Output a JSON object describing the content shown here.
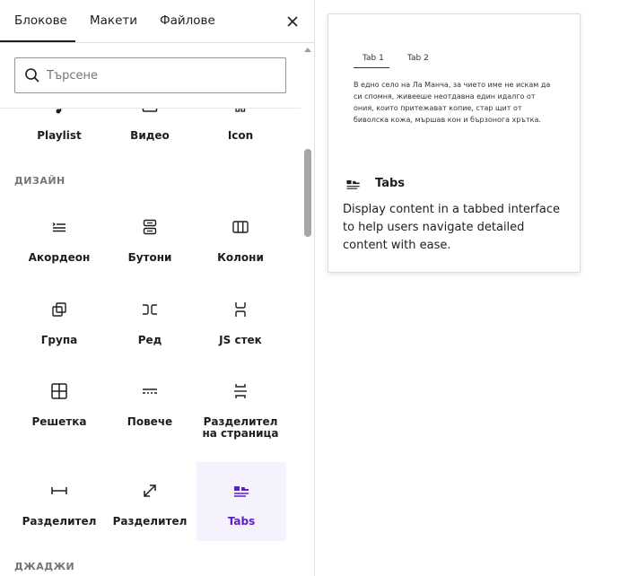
{
  "tabs": {
    "blocks": "Блокове",
    "patterns": "Макети",
    "media": "Файлове"
  },
  "search": {
    "placeholder": "Търсене"
  },
  "categories": {
    "design": "ДИЗАЙН",
    "widgets": "ДЖАДЖИ"
  },
  "blocks": {
    "playlist": "Playlist",
    "video": "Видео",
    "icon": "Icon",
    "accordion": "Акордеон",
    "buttons": "Бутони",
    "columns": "Колони",
    "group": "Група",
    "row": "Ред",
    "stack": "JS стек",
    "grid": "Решетка",
    "more": "Повече",
    "page_break": "Разделител на страница",
    "spacer": "Разделител",
    "separator": "Разделител",
    "tabs": "Tabs"
  },
  "preview": {
    "tab1": "Tab 1",
    "tab2": "Tab 2",
    "sample_text": "В едно село на Ла Манча, за чието име не искам да си спомня, живееше неотдавна един идалго от ония, които притежават копие, стар щит от биволска кожа, мършав кон и бързонога хрътка.",
    "title": "Tabs",
    "description": "Display content in a tabbed interface to help users navigate detailed content with ease."
  },
  "colors": {
    "accent": "#5b1fc8",
    "active_bg": "#f5f1fd"
  }
}
